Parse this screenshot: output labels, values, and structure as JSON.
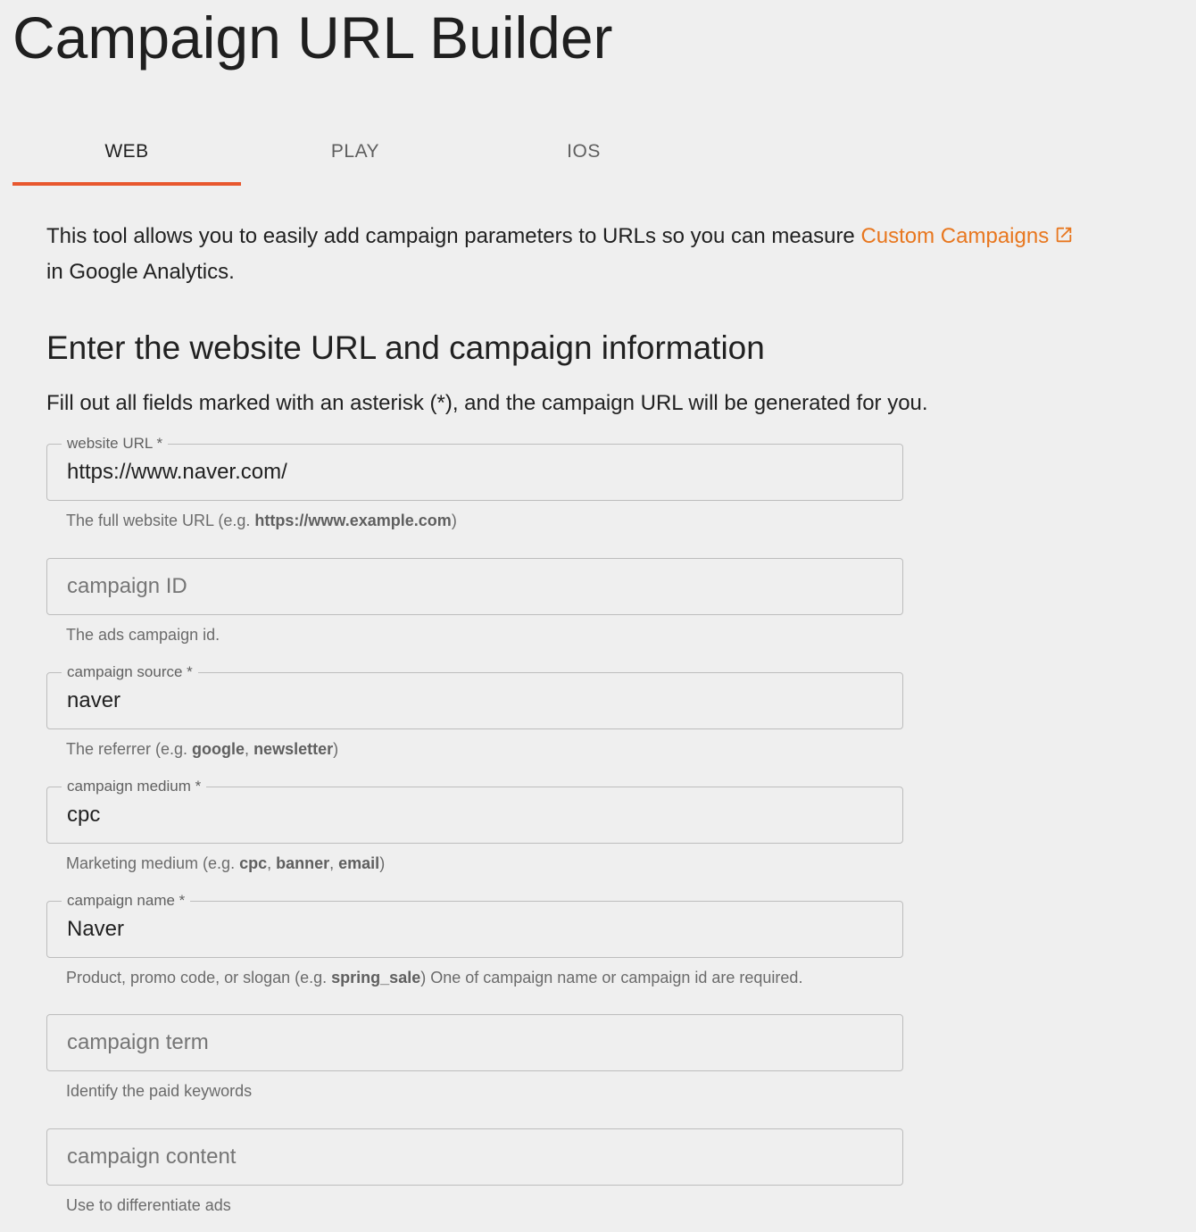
{
  "page": {
    "title": "Campaign URL Builder"
  },
  "tabs": [
    {
      "label": "WEB",
      "active": true
    },
    {
      "label": "PLAY",
      "active": false
    },
    {
      "label": "IOS",
      "active": false
    }
  ],
  "intro": {
    "text_before_link": "This tool allows you to easily add campaign parameters to URLs so you can measure ",
    "link_text": "Custom Campaigns",
    "link_icon": "external-link-icon",
    "text_after_link": "in Google Analytics."
  },
  "section": {
    "heading": "Enter the website URL and campaign information",
    "instructions": "Fill out all fields marked with an asterisk (*), and the campaign URL will be generated for you."
  },
  "fields": {
    "website_url": {
      "label": "website URL *",
      "value": "https://www.naver.com/",
      "placeholder": "",
      "helper_parts": [
        "The full website URL (e.g. ",
        "https://www.example.com",
        ")"
      ]
    },
    "campaign_id": {
      "label": "",
      "value": "",
      "placeholder": "campaign ID",
      "helper_parts": [
        "The ads campaign id."
      ]
    },
    "campaign_source": {
      "label": "campaign source *",
      "value": "naver",
      "placeholder": "",
      "helper_parts": [
        "The referrer (e.g. ",
        "google",
        ", ",
        "newsletter",
        ")"
      ]
    },
    "campaign_medium": {
      "label": "campaign medium *",
      "value": "cpc",
      "placeholder": "",
      "helper_parts": [
        "Marketing medium (e.g. ",
        "cpc",
        ", ",
        "banner",
        ", ",
        "email",
        ")"
      ]
    },
    "campaign_name": {
      "label": "campaign name *",
      "value": "Naver",
      "placeholder": "",
      "helper_parts": [
        "Product, promo code, or slogan (e.g. ",
        "spring_sale",
        ") One of campaign name or campaign id are required."
      ]
    },
    "campaign_term": {
      "label": "",
      "value": "",
      "placeholder": "campaign term",
      "helper_parts": [
        "Identify the paid keywords"
      ]
    },
    "campaign_content": {
      "label": "",
      "value": "",
      "placeholder": "campaign content",
      "helper_parts": [
        "Use to differentiate ads"
      ]
    }
  },
  "colors": {
    "background": "#efefef",
    "accent_tab_indicator": "#e8572e",
    "link": "#e8771f",
    "field_border": "#bdbdbd"
  }
}
